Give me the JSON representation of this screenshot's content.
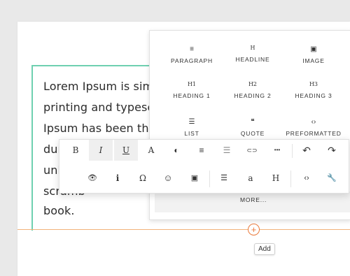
{
  "editor": {
    "text_lines": [
      "Lorem Ipsum is simply",
      "printing and typesetti",
      "Ipsum has been the",
      "dur",
      "unkno",
      "scramb",
      "book."
    ]
  },
  "paragraph_format_menu": {
    "items": [
      {
        "icon": "≡",
        "label": "PARAGRAPH"
      },
      {
        "icon": "H",
        "label": "HEADLINE"
      },
      {
        "icon": "▣",
        "label": "IMAGE"
      },
      {
        "icon": "H1",
        "label": "HEADING 1"
      },
      {
        "icon": "H2",
        "label": "HEADING 2"
      },
      {
        "icon": "H3",
        "label": "HEADING 3"
      },
      {
        "icon": "☰",
        "label": "LIST"
      },
      {
        "icon": "❝",
        "label": "QUOTE"
      },
      {
        "icon": "‹›",
        "label": "PREFORMATTED"
      }
    ],
    "more_label": "MORE..."
  },
  "toolbar": {
    "row1": [
      {
        "name": "bold-button",
        "glyph": "B"
      },
      {
        "name": "italic-button",
        "glyph": "I"
      },
      {
        "name": "underline-button",
        "glyph": "U"
      },
      {
        "name": "font-button",
        "glyph": "A"
      },
      {
        "name": "contrast-icon",
        "glyph": "◐"
      },
      {
        "name": "align-icon",
        "glyph": "≡"
      },
      {
        "name": "horizontal-rule-icon",
        "glyph": "☰"
      },
      {
        "name": "link-icon",
        "glyph": "⊂⊃"
      },
      {
        "name": "more-icon",
        "glyph": "•••"
      },
      {
        "name": "undo-icon",
        "glyph": "↶"
      },
      {
        "name": "redo-icon",
        "glyph": "↷"
      }
    ],
    "row2": [
      {
        "name": "preview-icon",
        "glyph": "👁"
      },
      {
        "name": "info-icon",
        "glyph": "i"
      },
      {
        "name": "special-char-icon",
        "glyph": "Ω"
      },
      {
        "name": "emoji-icon",
        "glyph": "☺"
      },
      {
        "name": "image-icon",
        "glyph": "▣"
      },
      {
        "name": "list-icon",
        "glyph": "☰"
      },
      {
        "name": "lowercase-icon",
        "glyph": "a"
      },
      {
        "name": "heading-icon",
        "glyph": "H"
      },
      {
        "name": "code-icon",
        "glyph": "‹›"
      },
      {
        "name": "wrench-icon",
        "glyph": "🔧"
      }
    ]
  },
  "add": {
    "button_glyph": "+",
    "tooltip": "Add"
  },
  "colors": {
    "block_border": "#6fd0b0",
    "add_accent": "#ea7a3c"
  }
}
